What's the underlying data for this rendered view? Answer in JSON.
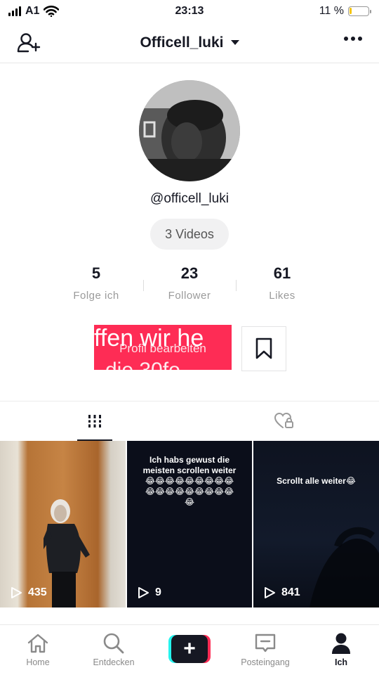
{
  "status_bar": {
    "carrier": "A1",
    "time": "23:13",
    "battery_percent": "11 %",
    "battery_level": 0.11
  },
  "header": {
    "username": "Officell_luki",
    "add_user_icon": "add-user-icon",
    "more_icon": "more-icon"
  },
  "profile": {
    "handle": "@officell_luki",
    "videos_count": "3 Videos"
  },
  "stats": [
    {
      "value": "5",
      "label": "Folge ich"
    },
    {
      "value": "23",
      "label": "Follower"
    },
    {
      "value": "61",
      "label": "Likes"
    }
  ],
  "actions": {
    "edit_profile": "Profil bearbeiten",
    "overlay_text_1": "ffen wir he",
    "overlay_text_2": "die 30fo",
    "bookmark_icon": "bookmark-icon"
  },
  "tabs": [
    {
      "name": "videos",
      "icon": "grid-icon",
      "active": true
    },
    {
      "name": "liked",
      "icon": "heart-lock-icon",
      "active": false
    }
  ],
  "videos": [
    {
      "caption": "",
      "views": "435"
    },
    {
      "caption": "Ich habs gewust die meisten scrollen weiter😂😂😂😂😂😂😂😂😂😂😂😂😂😂😂😂😂😂😂",
      "views": "9"
    },
    {
      "caption": "Scrollt alle weiter😂",
      "views": "841"
    }
  ],
  "bottom_nav": [
    {
      "label": "Home",
      "icon": "home-icon"
    },
    {
      "label": "Entdecken",
      "icon": "search-icon"
    },
    {
      "label": "",
      "icon": "create-icon"
    },
    {
      "label": "Posteingang",
      "icon": "inbox-icon"
    },
    {
      "label": "Ich",
      "icon": "profile-icon"
    }
  ],
  "colors": {
    "accent": "#fe2c55",
    "cyan": "#25f4ee",
    "text": "#161823"
  }
}
